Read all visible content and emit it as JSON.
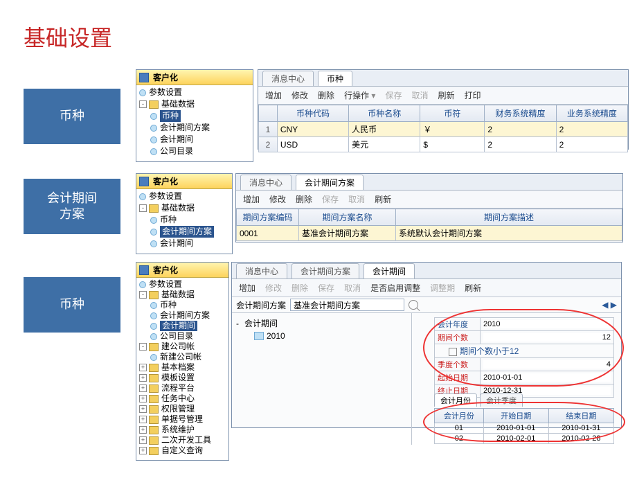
{
  "title": "基础设置",
  "side": {
    "b1": "币种",
    "b2": "会计期间\n方案",
    "b3": "币种"
  },
  "tree": {
    "hdr": "客户化",
    "param": "参数设置",
    "base": "基础数据",
    "currency": "币种",
    "period_plan": "会计期间方案",
    "period": "会计期间",
    "company": "公司目录",
    "new_comp": "新建公司帐",
    "build": "建公司帐",
    "basic_file": "基本档案",
    "tpl": "模板设置",
    "proc": "流程平台",
    "task": "任务中心",
    "auth": "权限管理",
    "bill": "单据号管理",
    "sys": "系统维护",
    "dev": "二次开发工具",
    "query": "自定义查询"
  },
  "tabs": {
    "msg": "消息中心",
    "currency": "币种",
    "plan": "会计期间方案",
    "period": "会计期间"
  },
  "tb": {
    "add": "增加",
    "edit": "修改",
    "del": "删除",
    "op": "行操作",
    "save": "保存",
    "cancel": "取消",
    "refresh": "刷新",
    "print": "打印",
    "enable": "是否启用调整",
    "adjust": "调整期"
  },
  "grid1": {
    "cols": {
      "code": "币种代码",
      "name": "币种名称",
      "sym": "币符",
      "fin": "财务系统精度",
      "biz": "业务系统精度"
    },
    "r1": {
      "code": "CNY",
      "name": "人民币",
      "sym": "￥",
      "fin": "2",
      "biz": "2"
    },
    "r2": {
      "code": "USD",
      "name": "美元",
      "sym": "$",
      "fin": "2",
      "biz": "2"
    }
  },
  "grid2": {
    "cols": {
      "code": "期间方案编码",
      "name": "期间方案名称",
      "desc": "期间方案描述"
    },
    "r1": {
      "code": "0001",
      "name": "基准会计期间方案",
      "desc": "系统默认会计期间方案"
    }
  },
  "p3": {
    "plan_lbl": "会计期间方案",
    "plan_val": "基准会计期间方案",
    "folder": "会计期间",
    "yr": "2010",
    "f": {
      "year_l": "会计年度",
      "year_v": "2010",
      "cnt_l": "期间个数",
      "cnt_v": "12",
      "note": "期间个数小于12",
      "q_l": "季度个数",
      "q_v": "4",
      "start_l": "起始日期",
      "start_v": "2010-01-01",
      "end_l": "终止日期",
      "end_v": "2010-12-31"
    },
    "sub": {
      "month": "会计月份",
      "quarter": "会计季度"
    },
    "mg": {
      "c1": "会计月份",
      "c2": "开始日期",
      "c3": "结束日期",
      "r1": {
        "m": "01",
        "s": "2010-01-01",
        "e": "2010-01-31"
      },
      "r2": {
        "m": "02",
        "s": "2010-02-01",
        "e": "2010-02-28"
      }
    }
  }
}
